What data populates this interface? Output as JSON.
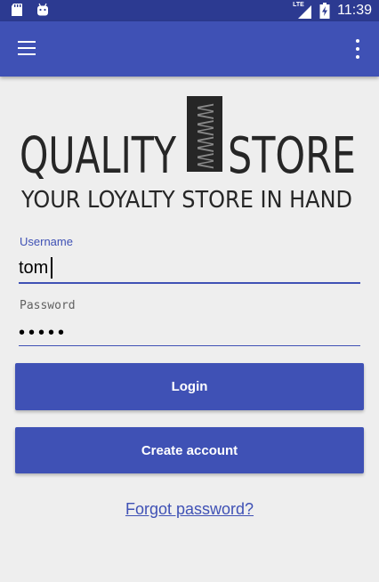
{
  "status_bar": {
    "time": "11:39",
    "network": "LTE",
    "icons": [
      "sd-card-icon",
      "android-icon",
      "lte-signal-icon",
      "battery-charging-icon"
    ]
  },
  "app_bar": {
    "menu_icon": "hamburger-menu-icon",
    "overflow_icon": "overflow-menu-icon"
  },
  "logo": {
    "brand_left": "QUALITY",
    "brand_right": "STORE",
    "mark": "WWWW",
    "tagline": "YOUR LOYALTY STORE IN HAND"
  },
  "form": {
    "username_label": "Username",
    "username_value": "tom",
    "password_label": "Password",
    "password_value": "•••••"
  },
  "buttons": {
    "login_label": "Login",
    "create_account_label": "Create account"
  },
  "links": {
    "forgot_password": "Forgot password?"
  },
  "colors": {
    "primary": "#3f51b5",
    "primary_dark": "#2c3a91",
    "background": "#eeeeee"
  }
}
